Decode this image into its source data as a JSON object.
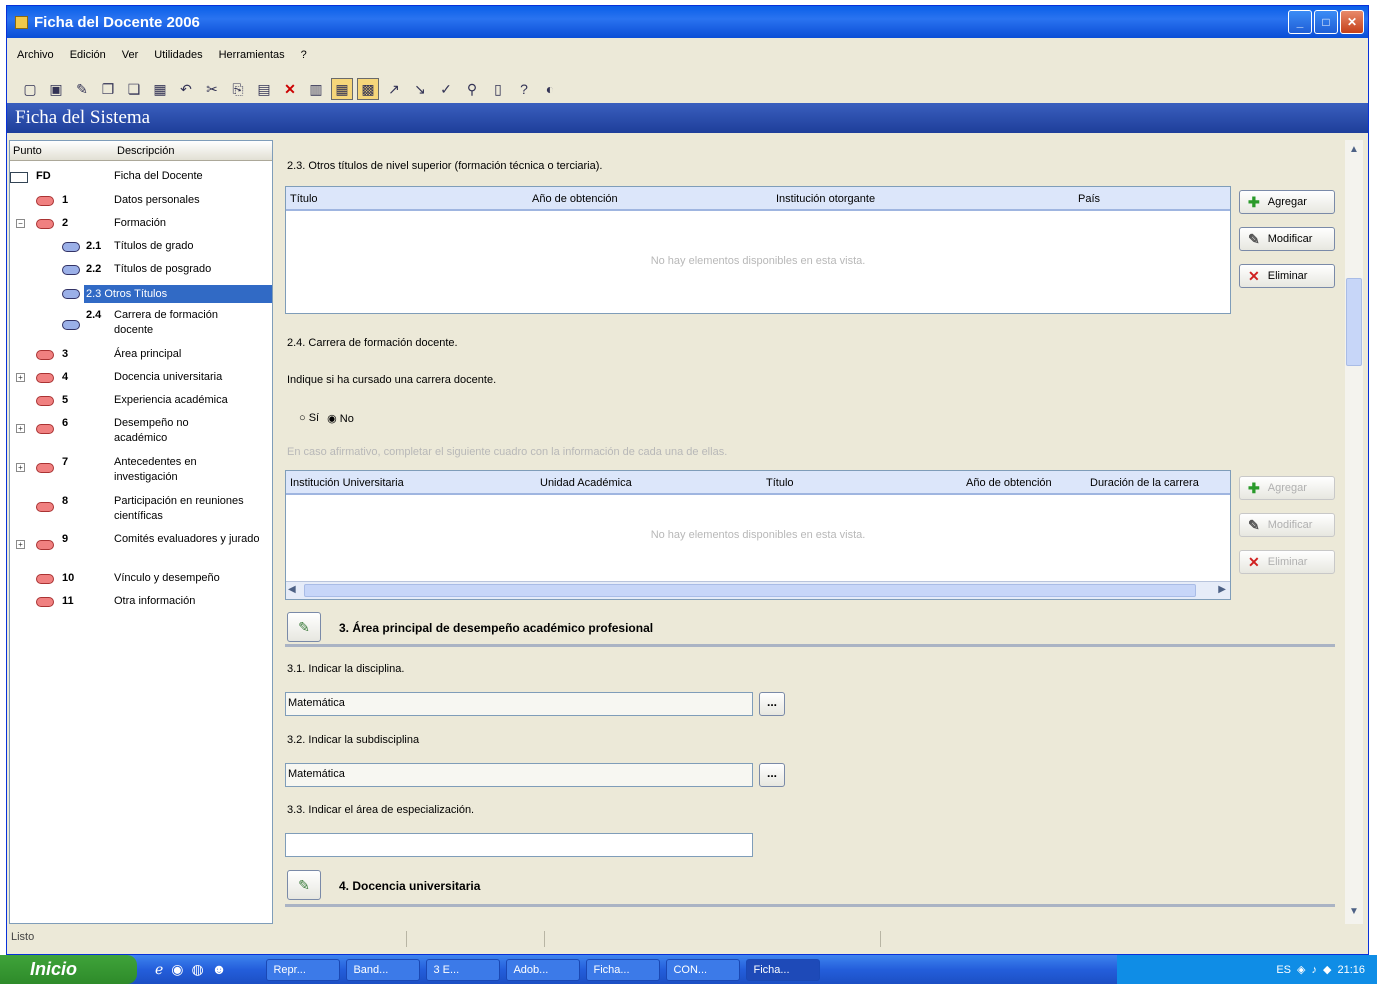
{
  "window": {
    "title": "Ficha del Docente 2006",
    "min": "_",
    "max": "□",
    "close": "✕"
  },
  "menu": [
    "Archivo",
    "Edición",
    "Ver",
    "Utilidades",
    "Herramientas",
    "?"
  ],
  "toolbar_icons": [
    "new-icon",
    "open-icon",
    "edit-icon",
    "copy-icon",
    "paste-icon",
    "save-icon",
    "undo-icon",
    "cut-icon",
    "copy2-icon",
    "paste2-icon",
    "delete-icon",
    "view-icon",
    "layout1-icon",
    "layout2-icon",
    "sort-asc-icon",
    "sort-desc-icon",
    "filter-icon",
    "find-icon",
    "print-icon",
    "help-icon",
    "info-icon"
  ],
  "system_header": "Ficha del Sistema",
  "tree": {
    "col_punto": "Punto",
    "col_desc": "Descripción",
    "items": [
      {
        "num": "FD",
        "desc": "Ficha del Docente"
      },
      {
        "num": "1",
        "desc": "Datos personales"
      },
      {
        "num": "2",
        "desc": "Formación"
      },
      {
        "num": "2.1",
        "desc": "Títulos de grado"
      },
      {
        "num": "2.2",
        "desc": "Títulos de posgrado"
      },
      {
        "num": "2.3",
        "desc": "Otros Títulos"
      },
      {
        "num": "2.4",
        "desc": "Carrera de formación docente"
      },
      {
        "num": "3",
        "desc": "Área principal"
      },
      {
        "num": "4",
        "desc": "Docencia universitaria"
      },
      {
        "num": "5",
        "desc": "Experiencia académica"
      },
      {
        "num": "6",
        "desc": "Desempeño no académico"
      },
      {
        "num": "7",
        "desc": "Antecedentes en investigación"
      },
      {
        "num": "8",
        "desc": "Participación en reuniones científicas"
      },
      {
        "num": "9",
        "desc": "Comités evaluadores y jurado"
      },
      {
        "num": "10",
        "desc": "Vínculo y desempeño"
      },
      {
        "num": "11",
        "desc": "Otra información"
      }
    ]
  },
  "section23": {
    "label": "2.3. Otros títulos de nivel superior (formación técnica o terciaria).",
    "cols": [
      "Título",
      "Año de obtención",
      "Institución otorgante",
      "País"
    ],
    "empty": "No hay elementos disponibles en esta vista.",
    "buttons": [
      "Agregar",
      "Modificar",
      "Eliminar"
    ]
  },
  "section24": {
    "label": "2.4. Carrera de formación docente.",
    "question": "Indique si ha cursado una carrera docente.",
    "radio_si": "Sí",
    "radio_no": "No",
    "hint": "En caso afirmativo, completar el siguiente cuadro con la información de cada una de ellas.",
    "cols": [
      "Institución Universitaria",
      "Unidad Académica",
      "Título",
      "Año de obtención",
      "Duración de la carrera"
    ],
    "empty": "No hay elementos disponibles en esta vista.",
    "buttons": [
      "Agregar",
      "Modificar",
      "Eliminar"
    ]
  },
  "section3": {
    "title": "3. Área principal de desempeño académico profesional",
    "q1": "3.1. Indicar la disciplina.",
    "v1": "Matemática",
    "q2": "3.2. Indicar la subdisciplina",
    "v2": "Matemática",
    "q3": "3.3. Indicar el área de especialización.",
    "v3": "",
    "dots": "..."
  },
  "section4": {
    "title": "4. Docencia universitaria"
  },
  "status": "Listo",
  "taskbar": {
    "start": "Inicio",
    "tasks": [
      "Repr...",
      "Band...",
      "3 E...",
      "Adob...",
      "Ficha...",
      "CON...",
      "Ficha..."
    ],
    "lang": "ES",
    "time": "21:16"
  }
}
